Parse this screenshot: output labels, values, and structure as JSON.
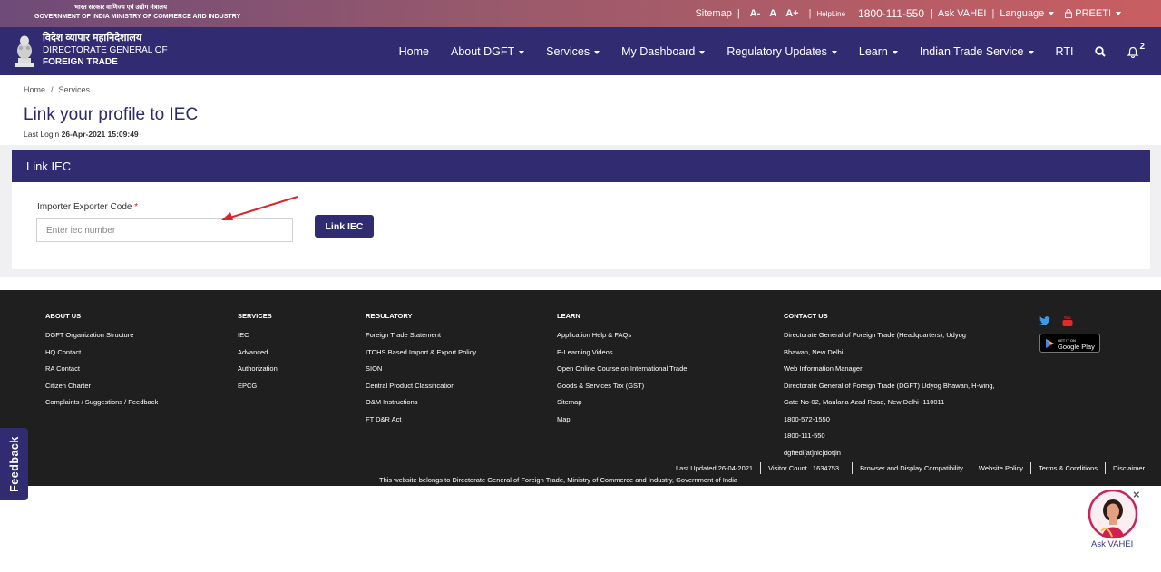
{
  "topbar": {
    "gov_hindi": "भारत सरकार   वाणिज्य एवं उद्योग मंत्रालय",
    "gov_english": "GOVERNMENT OF INDIA   MINISTRY OF COMMERCE AND INDUSTRY",
    "sitemap": "Sitemap",
    "font_small": "A-",
    "font_normal": "A",
    "font_large": "A+",
    "helpline_label": "HelpLine",
    "helpline_number": "1800-111-550",
    "ask_vahei": "Ask VAHEI",
    "language": "Language",
    "user": "PREETI",
    "separator": "|"
  },
  "brand": {
    "hindi": "विदेश व्यापार महानिदेशालय",
    "line1": "DIRECTORATE GENERAL OF",
    "line2": "FOREIGN TRADE"
  },
  "nav": {
    "items": [
      "Home",
      "About DGFT",
      "Services",
      "My Dashboard",
      "Regulatory Updates",
      "Learn",
      "Indian Trade Service",
      "RTI"
    ],
    "notification_count": "2"
  },
  "breadcrumb": {
    "home": "Home",
    "separator": "/",
    "current": "Services"
  },
  "page": {
    "title": "Link your profile to IEC",
    "last_login_label": "Last Login",
    "last_login_value": "26-Apr-2021 15:09:49"
  },
  "form": {
    "card_title": "Link IEC",
    "field_label": "Importer Exporter Code",
    "required_mark": "*",
    "placeholder": "Enter iec number",
    "value": "",
    "button_label": "Link IEC"
  },
  "footer": {
    "about": {
      "heading": "ABOUT US",
      "links": [
        "DGFT Organization Structure",
        "HQ Contact",
        "RA Contact",
        "Citizen Charter",
        "Complaints / Suggestions / Feedback"
      ]
    },
    "services": {
      "heading": "SERVICES",
      "links": [
        "IEC",
        "Advanced",
        "Authorization",
        "EPCG"
      ]
    },
    "regulatory": {
      "heading": "REGULATORY",
      "links": [
        "Foreign Trade Statement",
        "ITCHS Based Import & Export Policy",
        "SION",
        "Central Product Classification",
        "O&M Instructions",
        "FT D&R Act"
      ]
    },
    "learn": {
      "heading": "LEARN",
      "links": [
        "Application Help & FAQs",
        "E-Learning Videos",
        "Open Online Course on International Trade",
        "Goods & Services Tax (GST)",
        "Sitemap",
        "Map"
      ]
    },
    "contact": {
      "heading": "CONTACT US",
      "lines": [
        "Directorate General of Foreign Trade (Headquarters), Udyog",
        "Bhawan, New Delhi",
        "Web Information Manager:",
        "Directorate General of Foreign Trade (DGFT) Udyog Bhawan, H-wing,",
        "Gate No-02, Maulana Azad Road, New Delhi -110011",
        "1800-572-1550",
        "1800-111-550",
        "dgftedi[at]nic[dot]in"
      ]
    },
    "google_play_small": "GET IT ON",
    "google_play": "Google Play",
    "last_updated": "Last Updated 26-04-2021",
    "visitor_label": "Visitor Count",
    "visitor_count": "1634753",
    "bottom_links": [
      "Browser and Display Compatibility",
      "Website Policy",
      "Terms & Conditions",
      "Disclaimer"
    ],
    "belongs": "This website belongs to Directorate General of Foreign Trade, Ministry of Commerce and Industry, Government of India"
  },
  "feedback": {
    "label": "Feedback"
  },
  "vahei": {
    "label": "Ask VAHEI",
    "close": "×"
  },
  "colors": {
    "primary": "#312c72",
    "footer_bg": "#1f1f1f",
    "annotation_arrow": "#d9262b"
  }
}
